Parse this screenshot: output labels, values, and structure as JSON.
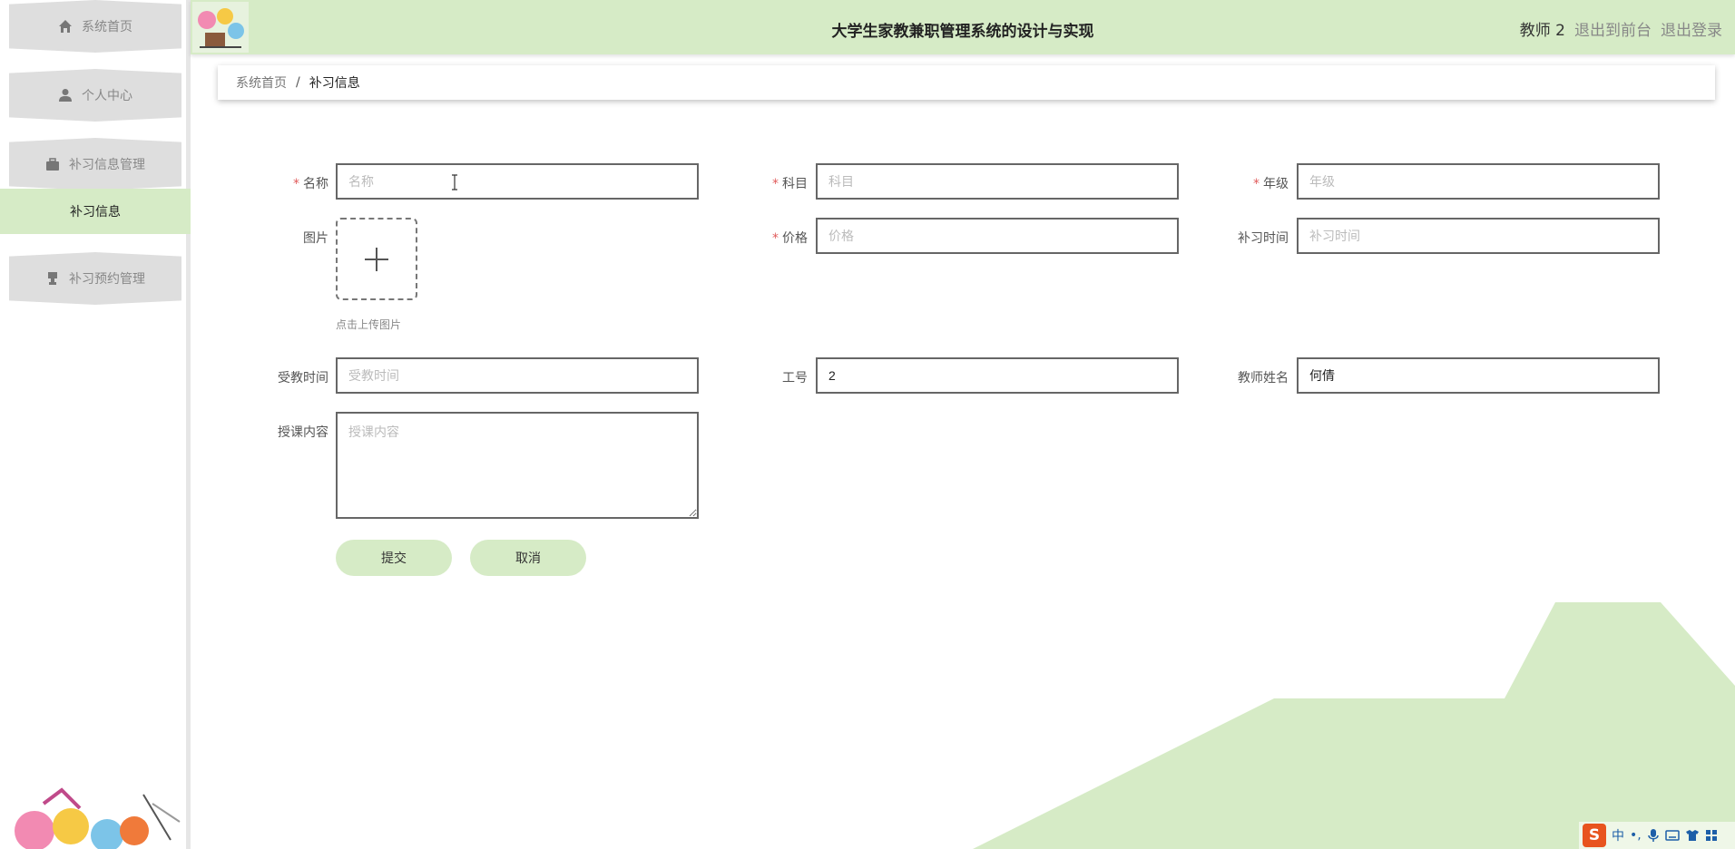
{
  "app": {
    "title": "大学生家教兼职管理系统的设计与实现",
    "user": "教师 2",
    "to_front": "退出到前台",
    "logout": "退出登录"
  },
  "sidebar": {
    "items": [
      {
        "label": "系统首页",
        "icon": "home-icon"
      },
      {
        "label": "个人中心",
        "icon": "user-icon"
      },
      {
        "label": "补习信息管理",
        "icon": "briefcase-icon"
      },
      {
        "label": "补习预约管理",
        "icon": "stamp-icon"
      }
    ],
    "sub_item": "补习信息"
  },
  "breadcrumb": {
    "home": "系统首页",
    "separator": "/",
    "current": "补习信息"
  },
  "form": {
    "name": {
      "label": "名称",
      "placeholder": "名称",
      "value": "",
      "required": true
    },
    "subject": {
      "label": "科目",
      "placeholder": "科目",
      "value": "",
      "required": true
    },
    "grade": {
      "label": "年级",
      "placeholder": "年级",
      "value": "",
      "required": true
    },
    "image": {
      "label": "图片",
      "hint": "点击上传图片"
    },
    "price": {
      "label": "价格",
      "placeholder": "价格",
      "value": "",
      "required": true
    },
    "tutor_time": {
      "label": "补习时间",
      "placeholder": "补习时间",
      "value": ""
    },
    "teaching_time": {
      "label": "受教时间",
      "placeholder": "受教时间",
      "value": ""
    },
    "job_no": {
      "label": "工号",
      "value": "2"
    },
    "teacher_name": {
      "label": "教师姓名",
      "value": "何倩"
    },
    "content": {
      "label": "授课内容",
      "placeholder": "授课内容",
      "value": ""
    },
    "required_mark": "*",
    "submit": "提交",
    "cancel": "取消"
  },
  "taskbar": {
    "ime_logo": "S",
    "ime_mode": "中",
    "ime_punct": "•,"
  },
  "colors": {
    "accent": "#d6ebc6",
    "required": "#e05a5a"
  }
}
